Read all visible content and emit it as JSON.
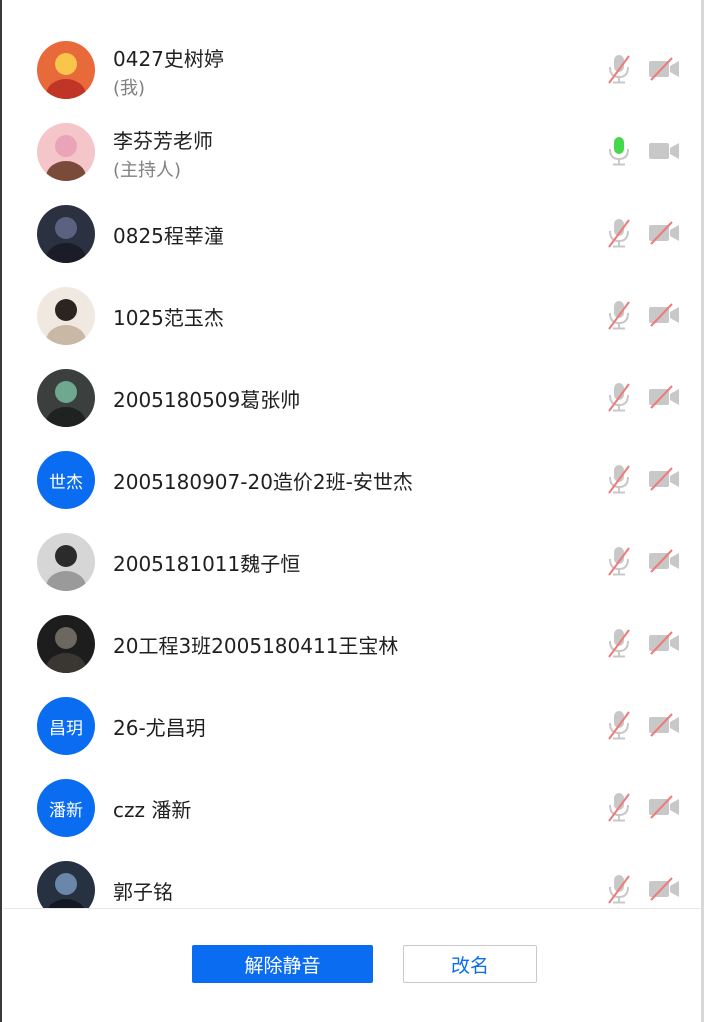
{
  "participants": [
    {
      "name": "0427史树婷",
      "role": "(我)",
      "avatar": "photo",
      "mic": "muted",
      "camera": "off"
    },
    {
      "name": "李芬芳老师",
      "role": "(主持人)",
      "avatar": "photo",
      "mic": "speaking",
      "camera": "idle"
    },
    {
      "name": "0825程莘潼",
      "role": "",
      "avatar": "photo",
      "mic": "muted",
      "camera": "off"
    },
    {
      "name": "1025范玉杰",
      "role": "",
      "avatar": "photo",
      "mic": "muted",
      "camera": "off"
    },
    {
      "name": "2005180509葛张帅",
      "role": "",
      "avatar": "photo",
      "mic": "muted",
      "camera": "off"
    },
    {
      "name": "2005180907-20造价2班-安世杰",
      "role": "",
      "avatar": "text",
      "avatar_text": "世杰",
      "mic": "muted",
      "camera": "off"
    },
    {
      "name": "2005181011魏子恒",
      "role": "",
      "avatar": "photo",
      "mic": "muted",
      "camera": "off"
    },
    {
      "name": "20工程3班2005180411王宝林",
      "role": "",
      "avatar": "photo",
      "mic": "muted",
      "camera": "off"
    },
    {
      "name": "26-尤昌玥",
      "role": "",
      "avatar": "text",
      "avatar_text": "昌玥",
      "mic": "muted",
      "camera": "off"
    },
    {
      "name": "czz 潘新",
      "role": "",
      "avatar": "text",
      "avatar_text": "潘新",
      "mic": "muted",
      "camera": "off"
    },
    {
      "name": "郭子铭",
      "role": "",
      "avatar": "photo",
      "mic": "muted",
      "camera": "off"
    }
  ],
  "footer": {
    "unmute_label": "解除静音",
    "rename_label": "改名"
  },
  "colors": {
    "accent": "#0a6cf1",
    "muted_slash": "#f07a7a",
    "icon_gray": "#c8c8c8",
    "speaking_green": "#45d84a"
  }
}
